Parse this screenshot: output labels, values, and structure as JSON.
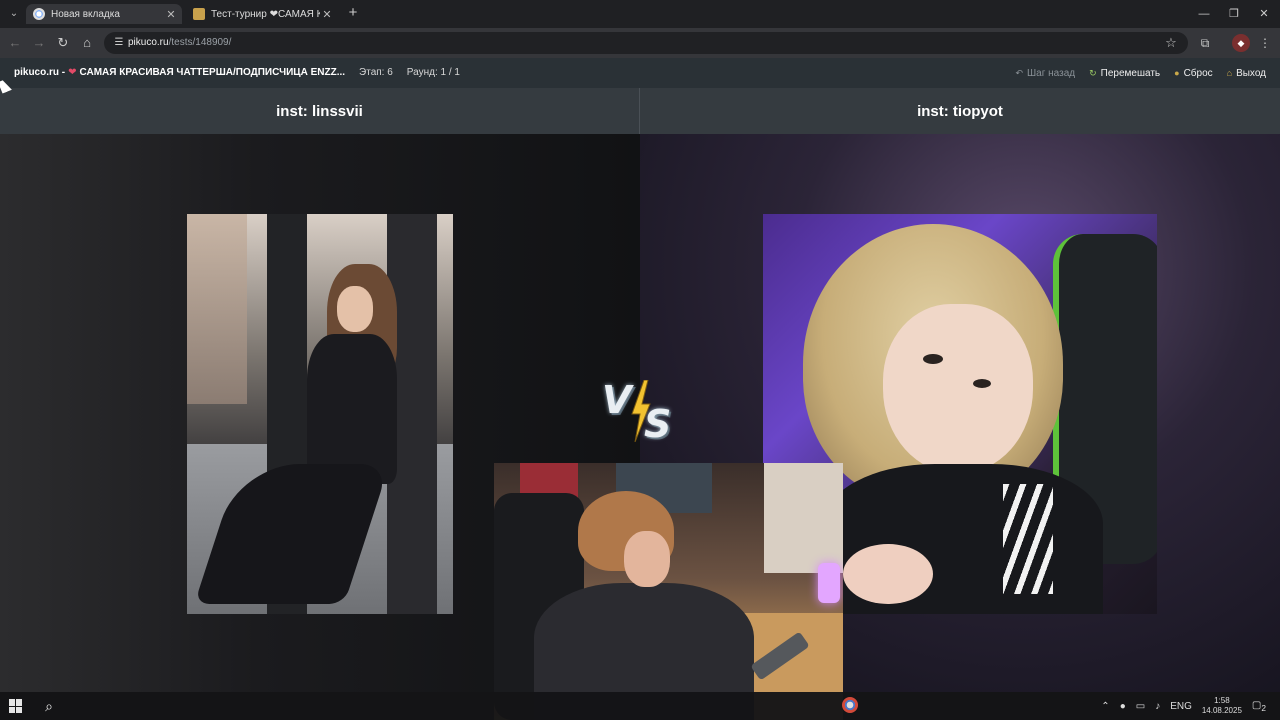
{
  "browser": {
    "tabs": [
      {
        "title": "Новая вкладка",
        "active": true
      },
      {
        "title": "Тест-турнир ❤САМАЯ КРАСИВ",
        "active": false
      }
    ],
    "url_host": "pikuco.ru",
    "url_path": "/tests/148909/"
  },
  "site": {
    "brand": "pikuco.ru -",
    "tournament_title": "САМАЯ КРАСИВАЯ ЧАТТЕРША/ПОДПИСЧИЦА ENZZ...",
    "stage": "Этап: 6",
    "round": "Раунд: 1 / 1",
    "buttons": {
      "back": "Шаг назад",
      "shuffle": "Перемешать",
      "reset": "Сброс",
      "exit": "Выход"
    }
  },
  "contest": {
    "left_caption": "inst: linssvii",
    "right_caption": "inst: tiopyot",
    "vs_v": "V",
    "vs_s": "S"
  },
  "taskbar": {
    "lang": "ENG",
    "time": "1:58",
    "date": "14.08.2025",
    "notifications": "2"
  },
  "colors": {
    "header_bg": "#2a3136",
    "caption_bg": "#353b40",
    "accent_heart": "#e24a67",
    "bolt": "#f2c230"
  },
  "icons": {
    "back": "undo-icon",
    "shuffle": "shuffle-icon",
    "reset": "reset-icon",
    "exit": "home-exit-icon"
  }
}
